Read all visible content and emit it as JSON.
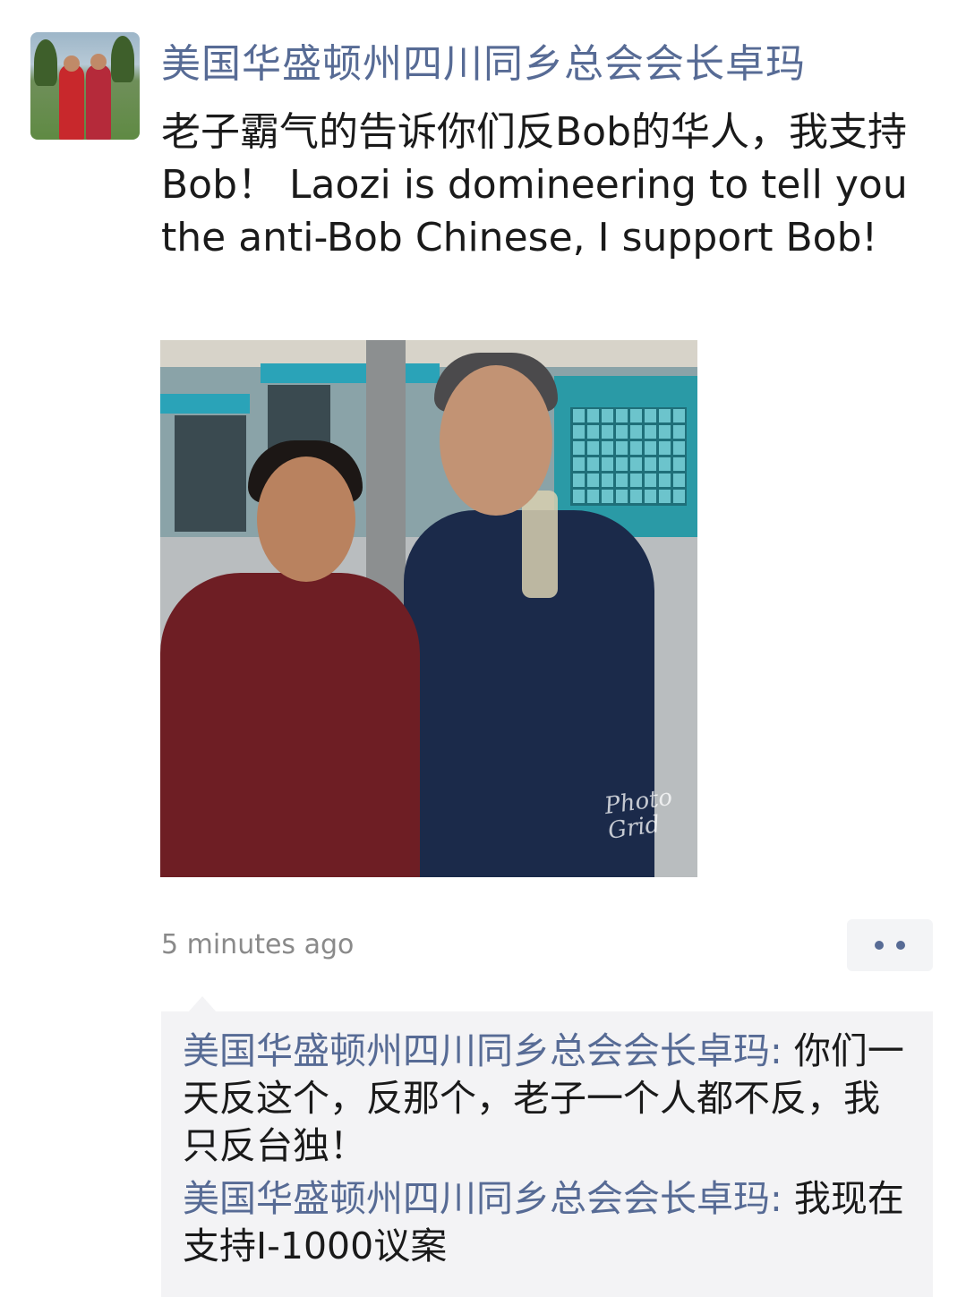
{
  "post": {
    "author": "美国华盛顿州四川同乡总会会长卓玛",
    "text": "老子霸气的告诉你们反Bob的华人，我支持Bob！ Laozi is domineering to tell you the anti-Bob Chinese, I support Bob!",
    "photo_watermark": "Photo Grid",
    "timestamp": "5 minutes ago"
  },
  "comments": [
    {
      "author": "美国华盛顿州四川同乡总会会长卓玛",
      "separator": ": ",
      "text": "你们一天反这个，反那个，老子一个人都不反，我只反台独！"
    },
    {
      "author": "美国华盛顿州四川同乡总会会长卓玛",
      "separator": ": ",
      "text": "我现在支持I-1000议案"
    }
  ],
  "colors": {
    "link": "#576b95",
    "text": "#1a1a1a",
    "muted": "#8a8a8a",
    "comment_bg": "#f3f3f5"
  },
  "icons": {
    "more": "more-dots-icon"
  }
}
